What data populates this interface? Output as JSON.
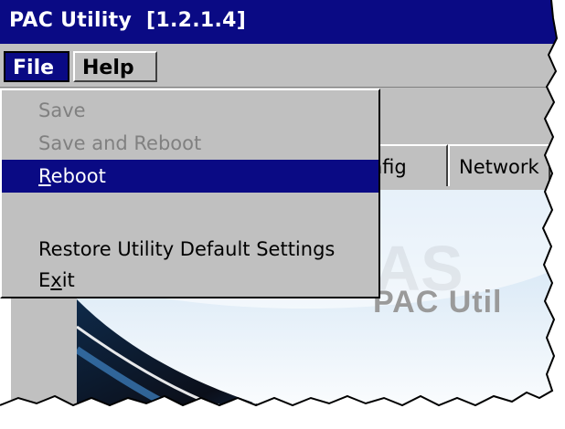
{
  "window": {
    "title": "PAC Utility  [1.2.1.4]"
  },
  "menubar": {
    "items": [
      {
        "label": "File",
        "state": "open"
      },
      {
        "label": "Help"
      }
    ]
  },
  "file_menu": {
    "items": [
      {
        "label": "Save",
        "disabled": true
      },
      {
        "label": "Save and Reboot",
        "disabled": true
      },
      {
        "label_pre": "",
        "mnemonic": "R",
        "label_post": "eboot",
        "selected": true
      },
      {
        "label": "Restore Utility Default Settings"
      },
      {
        "label_pre": "E",
        "mnemonic": "x",
        "label_post": "it"
      }
    ]
  },
  "tabs": [
    {
      "label": "onfig",
      "note": "partially hidden by menu"
    },
    {
      "label": "Network"
    }
  ],
  "splash": {
    "label": "PAC Util"
  },
  "colors": {
    "titlebar": "#0a0a84",
    "chrome": "#c0c0c0",
    "selection": "#0a0a84"
  }
}
